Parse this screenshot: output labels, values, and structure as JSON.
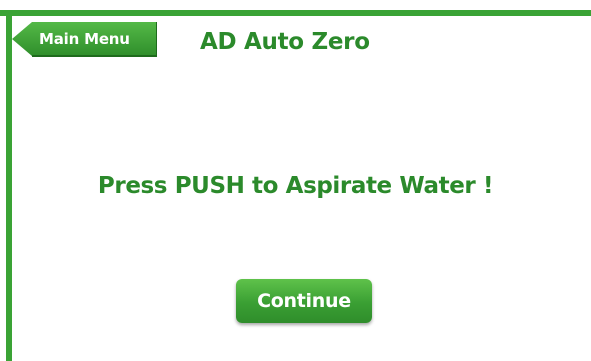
{
  "header": {
    "back_button_label": "Main Menu",
    "title": "AD Auto Zero"
  },
  "main": {
    "instruction": "Press PUSH to Aspirate Water !",
    "continue_label": "Continue"
  },
  "colors": {
    "accent_green": "#3aa335",
    "text_green": "#2b8a2b",
    "background": "#ffffff",
    "button_text": "#ffffff"
  },
  "icons": {
    "back": "back-arrow-icon"
  }
}
